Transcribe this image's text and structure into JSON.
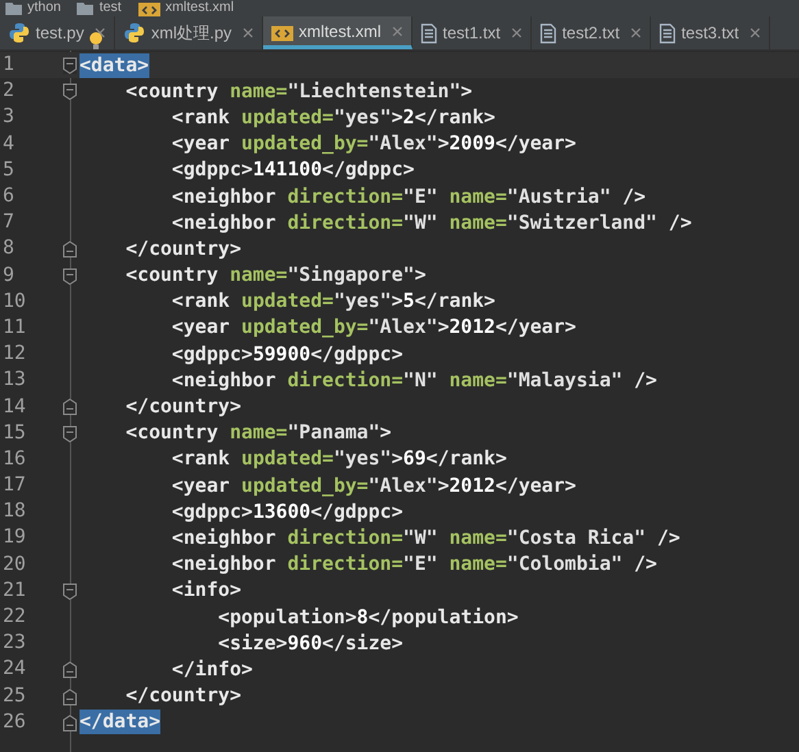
{
  "breadcrumb": [
    {
      "label": "ython",
      "kind": "folder"
    },
    {
      "label": "test",
      "kind": "folder"
    },
    {
      "label": "xmltest.xml",
      "kind": "xml"
    }
  ],
  "tabs": [
    {
      "label": "test.py",
      "kind": "python",
      "selected": false
    },
    {
      "label": "xml处理.py",
      "kind": "python",
      "selected": false
    },
    {
      "label": "xmltest.xml",
      "kind": "xml",
      "selected": true
    },
    {
      "label": "test1.txt",
      "kind": "text",
      "selected": false
    },
    {
      "label": "test2.txt",
      "kind": "text",
      "selected": false
    },
    {
      "label": "test3.txt",
      "kind": "text",
      "selected": false
    }
  ],
  "editor": {
    "lines": [
      {
        "number": "1",
        "fold_start": true,
        "fold_end": false,
        "current": true,
        "tokens": [
          {
            "kind": "tag",
            "text": "<data>",
            "matched": true
          }
        ]
      },
      {
        "number": "2",
        "fold_start": true,
        "fold_end": false,
        "current": false,
        "tokens": [
          {
            "kind": "tag",
            "text": "    <country "
          },
          {
            "kind": "attr",
            "text": "name="
          },
          {
            "kind": "value",
            "text": "\"Liechtenstein\""
          },
          {
            "kind": "tag",
            "text": ">"
          }
        ]
      },
      {
        "number": "3",
        "fold_start": false,
        "fold_end": false,
        "current": false,
        "tokens": [
          {
            "kind": "tag",
            "text": "        <rank "
          },
          {
            "kind": "attr",
            "text": "updated="
          },
          {
            "kind": "value",
            "text": "\"yes\""
          },
          {
            "kind": "tag",
            "text": ">"
          },
          {
            "kind": "text",
            "text": "2"
          },
          {
            "kind": "tag",
            "text": "</rank>"
          }
        ]
      },
      {
        "number": "4",
        "fold_start": false,
        "fold_end": false,
        "current": false,
        "tokens": [
          {
            "kind": "tag",
            "text": "        <year "
          },
          {
            "kind": "attr",
            "text": "updated_by="
          },
          {
            "kind": "value",
            "text": "\"Alex\""
          },
          {
            "kind": "tag",
            "text": ">"
          },
          {
            "kind": "text",
            "text": "2009"
          },
          {
            "kind": "tag",
            "text": "</year>"
          }
        ]
      },
      {
        "number": "5",
        "fold_start": false,
        "fold_end": false,
        "current": false,
        "tokens": [
          {
            "kind": "tag",
            "text": "        <gdppc>"
          },
          {
            "kind": "text",
            "text": "141100"
          },
          {
            "kind": "tag",
            "text": "</gdppc>"
          }
        ]
      },
      {
        "number": "6",
        "fold_start": false,
        "fold_end": false,
        "current": false,
        "tokens": [
          {
            "kind": "tag",
            "text": "        <neighbor "
          },
          {
            "kind": "attr",
            "text": "direction="
          },
          {
            "kind": "value",
            "text": "\"E\" "
          },
          {
            "kind": "attr",
            "text": "name="
          },
          {
            "kind": "value",
            "text": "\"Austria\" "
          },
          {
            "kind": "tag",
            "text": "/>"
          }
        ]
      },
      {
        "number": "7",
        "fold_start": false,
        "fold_end": false,
        "current": false,
        "tokens": [
          {
            "kind": "tag",
            "text": "        <neighbor "
          },
          {
            "kind": "attr",
            "text": "direction="
          },
          {
            "kind": "value",
            "text": "\"W\" "
          },
          {
            "kind": "attr",
            "text": "name="
          },
          {
            "kind": "value",
            "text": "\"Switzerland\" "
          },
          {
            "kind": "tag",
            "text": "/>"
          }
        ]
      },
      {
        "number": "8",
        "fold_start": false,
        "fold_end": true,
        "current": false,
        "tokens": [
          {
            "kind": "tag",
            "text": "    </country>"
          }
        ]
      },
      {
        "number": "9",
        "fold_start": true,
        "fold_end": false,
        "current": false,
        "tokens": [
          {
            "kind": "tag",
            "text": "    <country "
          },
          {
            "kind": "attr",
            "text": "name="
          },
          {
            "kind": "value",
            "text": "\"Singapore\""
          },
          {
            "kind": "tag",
            "text": ">"
          }
        ]
      },
      {
        "number": "10",
        "fold_start": false,
        "fold_end": false,
        "current": false,
        "tokens": [
          {
            "kind": "tag",
            "text": "        <rank "
          },
          {
            "kind": "attr",
            "text": "updated="
          },
          {
            "kind": "value",
            "text": "\"yes\""
          },
          {
            "kind": "tag",
            "text": ">"
          },
          {
            "kind": "text",
            "text": "5"
          },
          {
            "kind": "tag",
            "text": "</rank>"
          }
        ]
      },
      {
        "number": "11",
        "fold_start": false,
        "fold_end": false,
        "current": false,
        "tokens": [
          {
            "kind": "tag",
            "text": "        <year "
          },
          {
            "kind": "attr",
            "text": "updated_by="
          },
          {
            "kind": "value",
            "text": "\"Alex\""
          },
          {
            "kind": "tag",
            "text": ">"
          },
          {
            "kind": "text",
            "text": "2012"
          },
          {
            "kind": "tag",
            "text": "</year>"
          }
        ]
      },
      {
        "number": "12",
        "fold_start": false,
        "fold_end": false,
        "current": false,
        "tokens": [
          {
            "kind": "tag",
            "text": "        <gdppc>"
          },
          {
            "kind": "text",
            "text": "59900"
          },
          {
            "kind": "tag",
            "text": "</gdppc>"
          }
        ]
      },
      {
        "number": "13",
        "fold_start": false,
        "fold_end": false,
        "current": false,
        "tokens": [
          {
            "kind": "tag",
            "text": "        <neighbor "
          },
          {
            "kind": "attr",
            "text": "direction="
          },
          {
            "kind": "value",
            "text": "\"N\" "
          },
          {
            "kind": "attr",
            "text": "name="
          },
          {
            "kind": "value",
            "text": "\"Malaysia\" "
          },
          {
            "kind": "tag",
            "text": "/>"
          }
        ]
      },
      {
        "number": "14",
        "fold_start": false,
        "fold_end": true,
        "current": false,
        "tokens": [
          {
            "kind": "tag",
            "text": "    </country>"
          }
        ]
      },
      {
        "number": "15",
        "fold_start": true,
        "fold_end": false,
        "current": false,
        "tokens": [
          {
            "kind": "tag",
            "text": "    <country "
          },
          {
            "kind": "attr",
            "text": "name="
          },
          {
            "kind": "value",
            "text": "\"Panama\""
          },
          {
            "kind": "tag",
            "text": ">"
          }
        ]
      },
      {
        "number": "16",
        "fold_start": false,
        "fold_end": false,
        "current": false,
        "tokens": [
          {
            "kind": "tag",
            "text": "        <rank "
          },
          {
            "kind": "attr",
            "text": "updated="
          },
          {
            "kind": "value",
            "text": "\"yes\""
          },
          {
            "kind": "tag",
            "text": ">"
          },
          {
            "kind": "text",
            "text": "69"
          },
          {
            "kind": "tag",
            "text": "</rank>"
          }
        ]
      },
      {
        "number": "17",
        "fold_start": false,
        "fold_end": false,
        "current": false,
        "tokens": [
          {
            "kind": "tag",
            "text": "        <year "
          },
          {
            "kind": "attr",
            "text": "updated_by="
          },
          {
            "kind": "value",
            "text": "\"Alex\""
          },
          {
            "kind": "tag",
            "text": ">"
          },
          {
            "kind": "text",
            "text": "2012"
          },
          {
            "kind": "tag",
            "text": "</year>"
          }
        ]
      },
      {
        "number": "18",
        "fold_start": false,
        "fold_end": false,
        "current": false,
        "tokens": [
          {
            "kind": "tag",
            "text": "        <gdppc>"
          },
          {
            "kind": "text",
            "text": "13600"
          },
          {
            "kind": "tag",
            "text": "</gdppc>"
          }
        ]
      },
      {
        "number": "19",
        "fold_start": false,
        "fold_end": false,
        "current": false,
        "tokens": [
          {
            "kind": "tag",
            "text": "        <neighbor "
          },
          {
            "kind": "attr",
            "text": "direction="
          },
          {
            "kind": "value",
            "text": "\"W\" "
          },
          {
            "kind": "attr",
            "text": "name="
          },
          {
            "kind": "value",
            "text": "\"Costa Rica\" "
          },
          {
            "kind": "tag",
            "text": "/>"
          }
        ]
      },
      {
        "number": "20",
        "fold_start": false,
        "fold_end": false,
        "current": false,
        "tokens": [
          {
            "kind": "tag",
            "text": "        <neighbor "
          },
          {
            "kind": "attr",
            "text": "direction="
          },
          {
            "kind": "value",
            "text": "\"E\" "
          },
          {
            "kind": "attr",
            "text": "name="
          },
          {
            "kind": "value",
            "text": "\"Colombia\" "
          },
          {
            "kind": "tag",
            "text": "/>"
          }
        ]
      },
      {
        "number": "21",
        "fold_start": true,
        "fold_end": false,
        "current": false,
        "tokens": [
          {
            "kind": "tag",
            "text": "        <info>"
          }
        ]
      },
      {
        "number": "22",
        "fold_start": false,
        "fold_end": false,
        "current": false,
        "tokens": [
          {
            "kind": "tag",
            "text": "            <population>"
          },
          {
            "kind": "text",
            "text": "8"
          },
          {
            "kind": "tag",
            "text": "</population>"
          }
        ]
      },
      {
        "number": "23",
        "fold_start": false,
        "fold_end": false,
        "current": false,
        "tokens": [
          {
            "kind": "tag",
            "text": "            <size>"
          },
          {
            "kind": "text",
            "text": "960"
          },
          {
            "kind": "tag",
            "text": "</size>"
          }
        ]
      },
      {
        "number": "24",
        "fold_start": false,
        "fold_end": true,
        "current": false,
        "tokens": [
          {
            "kind": "tag",
            "text": "        </info>"
          }
        ]
      },
      {
        "number": "25",
        "fold_start": false,
        "fold_end": true,
        "current": false,
        "tokens": [
          {
            "kind": "tag",
            "text": "    </country>"
          }
        ]
      },
      {
        "number": "26",
        "fold_start": false,
        "fold_end": true,
        "current": false,
        "tokens": [
          {
            "kind": "tag",
            "text": "</data>",
            "matched": true
          }
        ]
      }
    ]
  }
}
